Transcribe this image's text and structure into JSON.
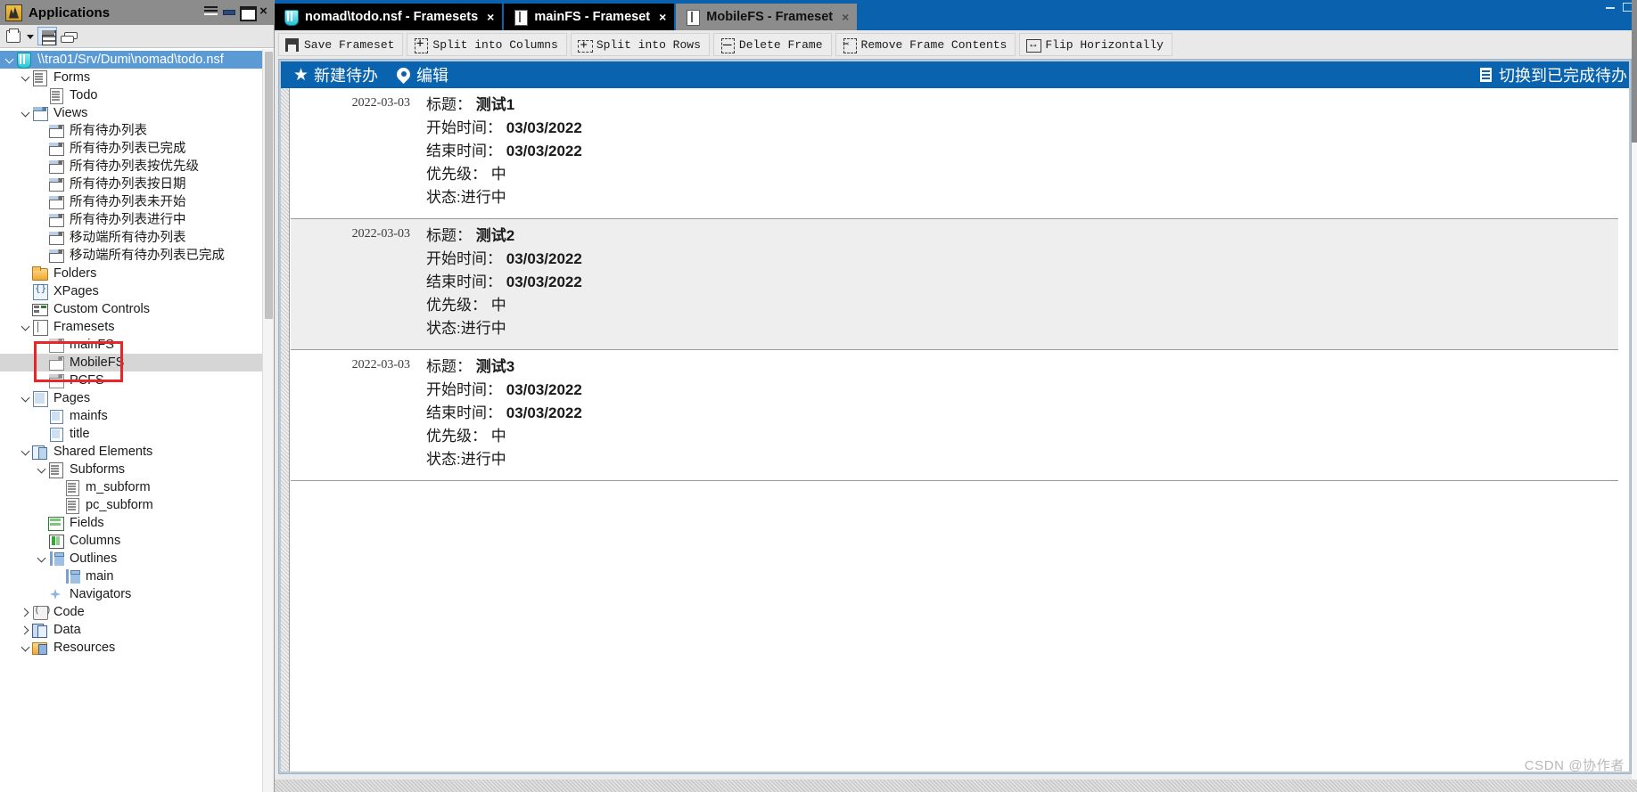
{
  "left_pane": {
    "title": "Applications",
    "title_icon": "notes-app-icon",
    "window_buttons": [
      "menu-icon",
      "minimize-icon",
      "maximize-icon",
      "close-icon"
    ],
    "toolbar_icons": [
      "new-application-icon",
      "dropdown-caret-icon",
      "show-list-view-icon",
      "stack-view-icon"
    ],
    "tree": [
      {
        "label": "\\\\tra01/Srv/Dumi\\nomad\\todo.nsf",
        "indent": 0,
        "icon": "database-icon",
        "twisty": "open",
        "selected": true
      },
      {
        "label": "Forms",
        "indent": 1,
        "icon": "forms-icon",
        "twisty": "open",
        "selected": false
      },
      {
        "label": "Todo",
        "indent": 2,
        "icon": "form-icon",
        "twisty": "none",
        "selected": false
      },
      {
        "label": "Views",
        "indent": 1,
        "icon": "views-icon",
        "twisty": "open",
        "selected": false
      },
      {
        "label": "所有待办列表",
        "indent": 2,
        "icon": "view-icon",
        "twisty": "none",
        "selected": false
      },
      {
        "label": "所有待办列表已完成",
        "indent": 2,
        "icon": "view-icon",
        "twisty": "none",
        "selected": false
      },
      {
        "label": "所有待办列表按优先级",
        "indent": 2,
        "icon": "view-icon",
        "twisty": "none",
        "selected": false
      },
      {
        "label": "所有待办列表按日期",
        "indent": 2,
        "icon": "view-icon",
        "twisty": "none",
        "selected": false
      },
      {
        "label": "所有待办列表未开始",
        "indent": 2,
        "icon": "view-icon",
        "twisty": "none",
        "selected": false
      },
      {
        "label": "所有待办列表进行中",
        "indent": 2,
        "icon": "view-icon",
        "twisty": "none",
        "selected": false
      },
      {
        "label": "移动端所有待办列表",
        "indent": 2,
        "icon": "view-icon",
        "twisty": "none",
        "selected": false
      },
      {
        "label": "移动端所有待办列表已完成",
        "indent": 2,
        "icon": "view-icon",
        "twisty": "none",
        "selected": false
      },
      {
        "label": "Folders",
        "indent": 1,
        "icon": "folder-icon",
        "twisty": "none",
        "selected": false
      },
      {
        "label": "XPages",
        "indent": 1,
        "icon": "xpages-icon",
        "twisty": "none",
        "selected": false
      },
      {
        "label": "Custom Controls",
        "indent": 1,
        "icon": "custom-controls-icon",
        "twisty": "none",
        "selected": false
      },
      {
        "label": "Framesets",
        "indent": 1,
        "icon": "frameset-group-icon",
        "twisty": "open",
        "selected": false
      },
      {
        "label": "mainFS",
        "indent": 2,
        "icon": "frameset-icon",
        "twisty": "none",
        "selected": false
      },
      {
        "label": "MobileFS",
        "indent": 2,
        "icon": "frameset-icon",
        "twisty": "none",
        "selected": false,
        "highlighted": true
      },
      {
        "label": "PCFS",
        "indent": 2,
        "icon": "frameset-icon",
        "twisty": "none",
        "selected": false
      },
      {
        "label": "Pages",
        "indent": 1,
        "icon": "pages-icon",
        "twisty": "open",
        "selected": false
      },
      {
        "label": "mainfs",
        "indent": 2,
        "icon": "page-icon",
        "twisty": "none",
        "selected": false
      },
      {
        "label": "title",
        "indent": 2,
        "icon": "page-icon",
        "twisty": "none",
        "selected": false
      },
      {
        "label": "Shared Elements",
        "indent": 1,
        "icon": "shared-elements-icon",
        "twisty": "open",
        "selected": false
      },
      {
        "label": "Subforms",
        "indent": 2,
        "icon": "subforms-icon",
        "twisty": "open",
        "selected": false
      },
      {
        "label": "m_subform",
        "indent": 3,
        "icon": "subform-icon",
        "twisty": "none",
        "selected": false
      },
      {
        "label": "pc_subform",
        "indent": 3,
        "icon": "subform-icon",
        "twisty": "none",
        "selected": false
      },
      {
        "label": "Fields",
        "indent": 2,
        "icon": "fields-icon",
        "twisty": "none",
        "selected": false
      },
      {
        "label": "Columns",
        "indent": 2,
        "icon": "columns-icon",
        "twisty": "none",
        "selected": false
      },
      {
        "label": "Outlines",
        "indent": 2,
        "icon": "outlines-icon",
        "twisty": "open",
        "selected": false
      },
      {
        "label": "main",
        "indent": 3,
        "icon": "outline-icon",
        "twisty": "none",
        "selected": false
      },
      {
        "label": "Navigators",
        "indent": 2,
        "icon": "navigators-icon",
        "twisty": "none",
        "selected": false
      },
      {
        "label": "Code",
        "indent": 1,
        "icon": "code-icon",
        "twisty": "closed",
        "selected": false
      },
      {
        "label": "Data",
        "indent": 1,
        "icon": "data-icon",
        "twisty": "closed",
        "selected": false
      },
      {
        "label": "Resources",
        "indent": 1,
        "icon": "resources-icon",
        "twisty": "open",
        "selected": false
      }
    ],
    "highlight_color": "#e8262a"
  },
  "tabs": [
    {
      "label": "nomad\\todo.nsf - Framesets",
      "icon": "database-icon",
      "active": false,
      "close_label": "×"
    },
    {
      "label": "mainFS - Frameset",
      "icon": "frameset-icon",
      "active": false,
      "close_label": "×"
    },
    {
      "label": "MobileFS - Frameset",
      "icon": "frameset-icon",
      "active": true,
      "close_label": "×"
    }
  ],
  "toolbar": {
    "buttons": [
      {
        "label": "Save Frameset",
        "icon": "save-icon"
      },
      {
        "label": "Split into Columns",
        "icon": "split-columns-icon"
      },
      {
        "label": "Split into Rows",
        "icon": "split-rows-icon"
      },
      {
        "label": "Delete Frame",
        "icon": "delete-frame-icon"
      },
      {
        "label": "Remove Frame Contents",
        "icon": "remove-contents-icon"
      },
      {
        "label": "Flip Horizontally",
        "icon": "flip-horizontal-icon"
      }
    ]
  },
  "action_bar": {
    "background": "#0a63ae",
    "left_actions": [
      {
        "label": "新建待办",
        "icon": "star-icon"
      },
      {
        "label": "编辑",
        "icon": "edit-pin-icon"
      }
    ],
    "right_actions": [
      {
        "label": "切换到已完成待办",
        "icon": "switch-doc-icon"
      }
    ]
  },
  "todo_list": {
    "field_labels": {
      "title": "标题：",
      "start": "开始时间：",
      "end": "结束时间：",
      "priority": "优先级：",
      "status": "状态:进行中"
    },
    "rows": [
      {
        "date": "2022-03-03",
        "title": "测试1",
        "start": "03/03/2022",
        "end": "03/03/2022",
        "priority": "中",
        "status": "状态:进行中"
      },
      {
        "date": "2022-03-03",
        "title": "测试2",
        "start": "03/03/2022",
        "end": "03/03/2022",
        "priority": "中",
        "status": "状态:进行中"
      },
      {
        "date": "2022-03-03",
        "title": "测试3",
        "start": "03/03/2022",
        "end": "03/03/2022",
        "priority": "中",
        "status": "状态:进行中"
      }
    ]
  },
  "watermark": "CSDN @协作者"
}
